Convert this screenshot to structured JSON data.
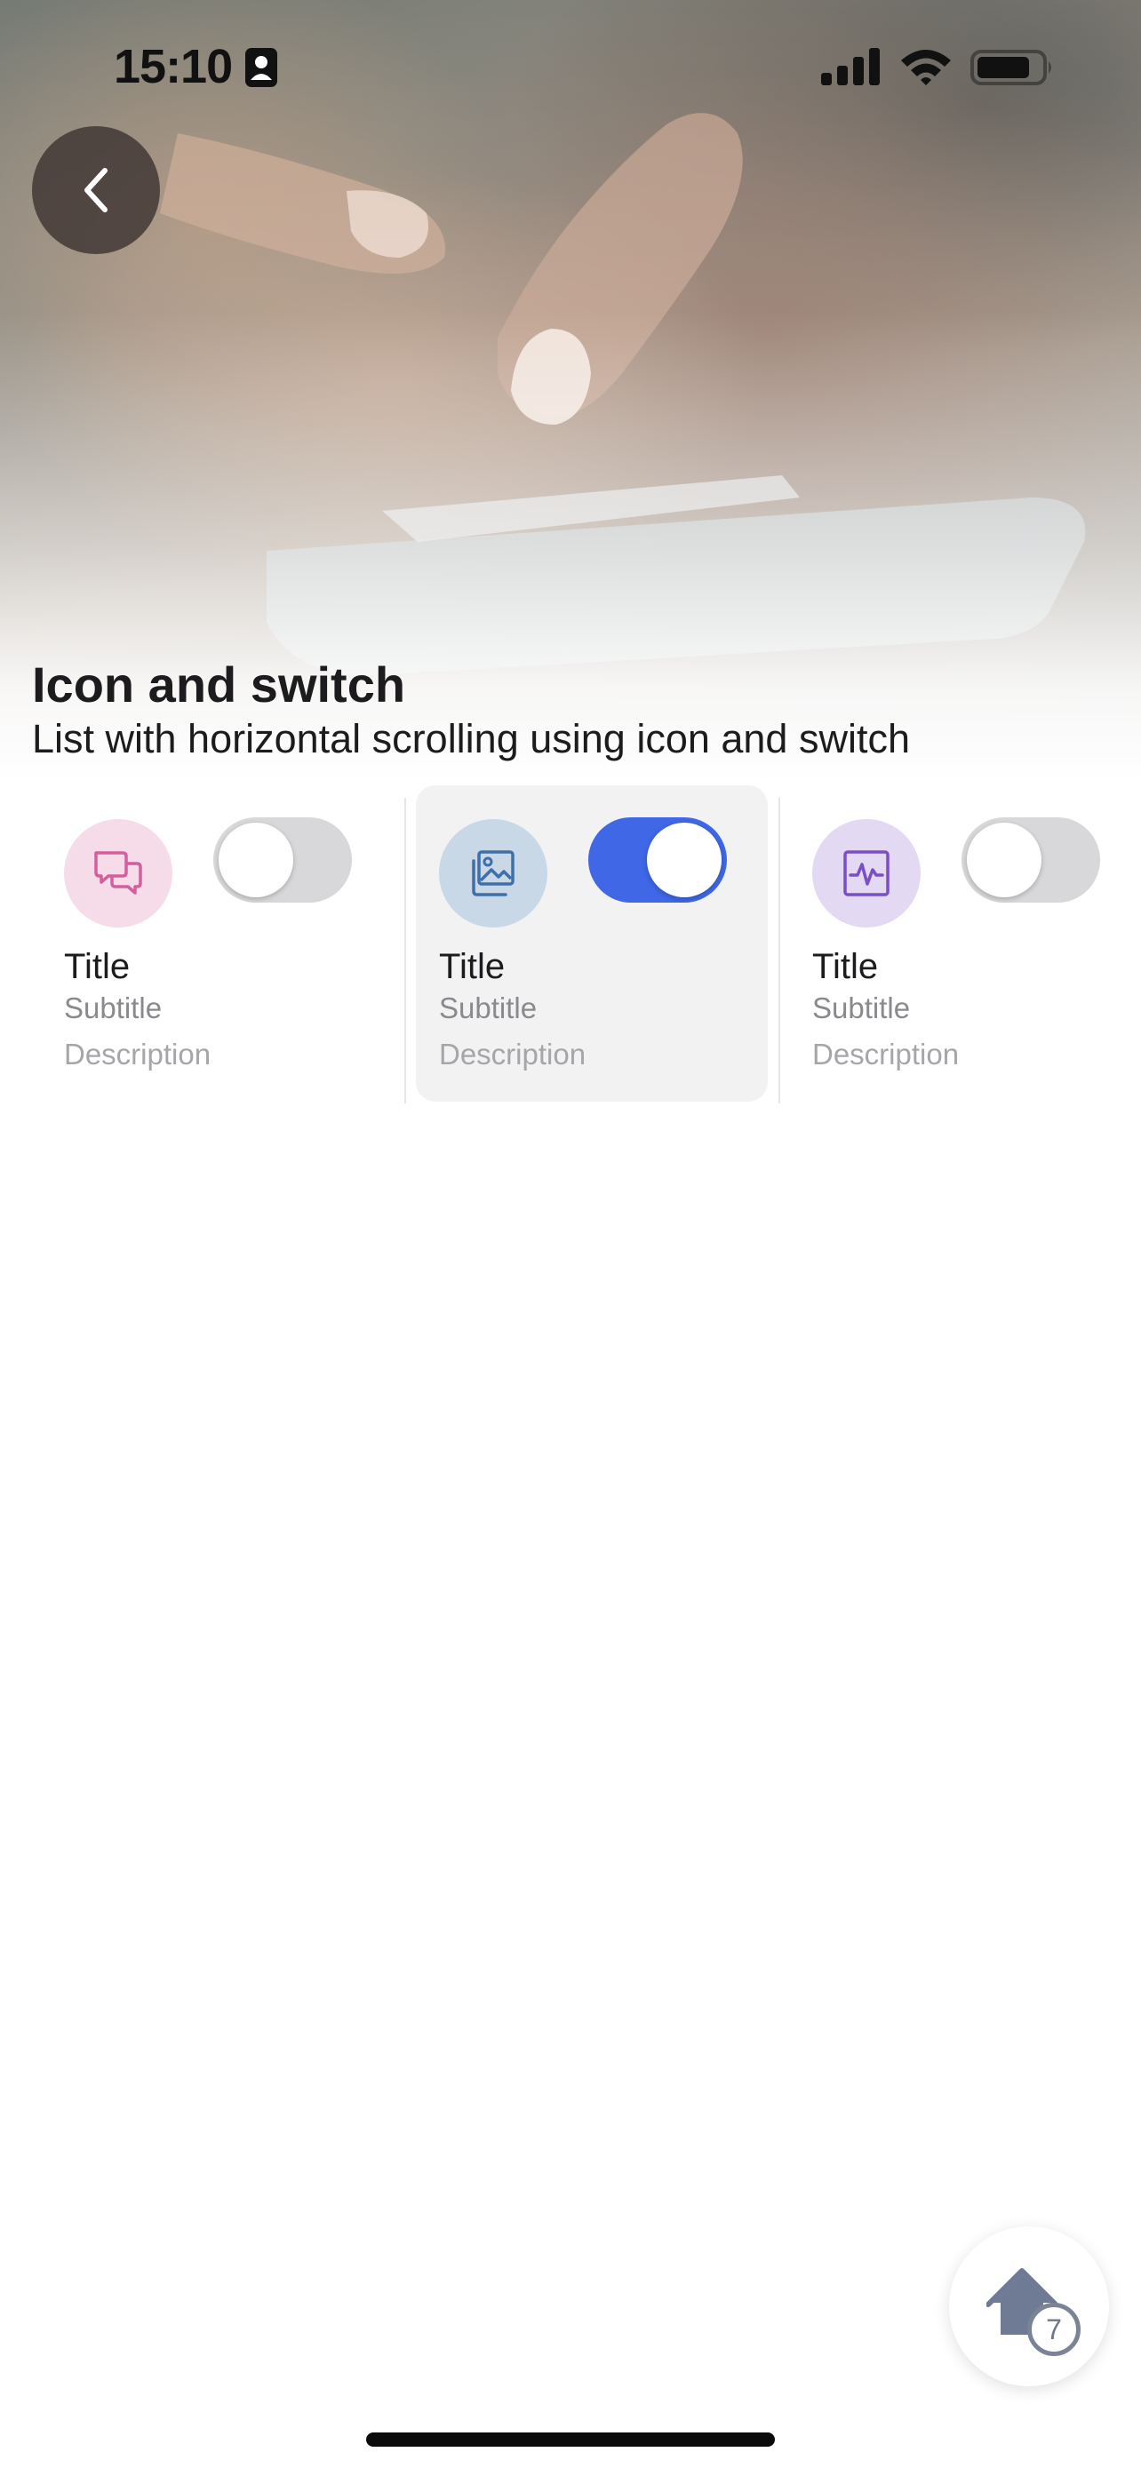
{
  "status_bar": {
    "time": "15:10",
    "icons": [
      "contact-card-icon",
      "cellular-signal-icon",
      "wifi-icon",
      "battery-icon"
    ]
  },
  "hero": {
    "image": "hand-holding-smartphone-photo",
    "back_icon": "chevron-left-icon"
  },
  "header": {
    "title": "Icon and switch",
    "subtitle": "List with horizontal scrolling using icon and switch"
  },
  "cards": [
    {
      "icon": "chat-bubbles-icon",
      "icon_color": "#d35f9f",
      "icon_bg": "#f6dce9",
      "title": "Title",
      "subtitle": "Subtitle",
      "description": "Description",
      "switch_on": false,
      "selected": false
    },
    {
      "icon": "image-gallery-icon",
      "icon_color": "#3e6fa8",
      "icon_bg": "#c9d8e6",
      "title": "Title",
      "subtitle": "Subtitle",
      "description": "Description",
      "switch_on": true,
      "selected": true
    },
    {
      "icon": "activity-pulse-icon",
      "icon_color": "#7b4fc4",
      "icon_bg": "#e3d9f2",
      "title": "Title",
      "subtitle": "Subtitle",
      "description": "Description",
      "switch_on": false,
      "selected": false
    }
  ],
  "colors": {
    "switch_on": "#3f67e6",
    "switch_off": "#d8d8da",
    "selected_card_bg": "#f2f2f3"
  },
  "home_button": {
    "icon": "home-icon",
    "badge": "7"
  }
}
